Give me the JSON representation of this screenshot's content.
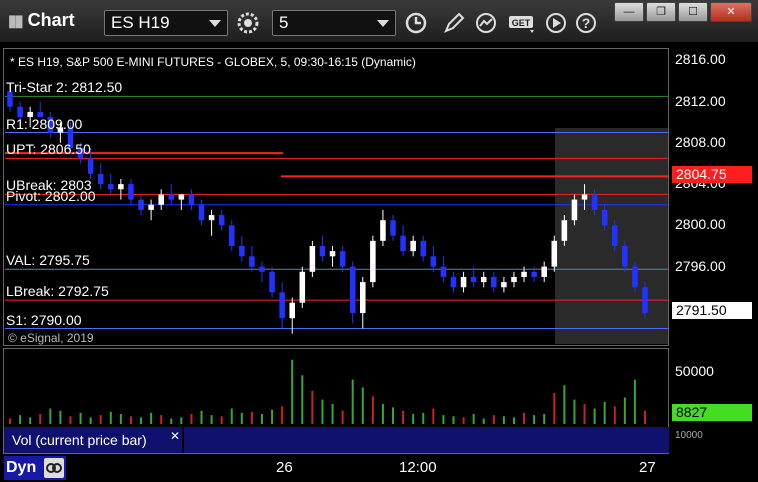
{
  "window": {
    "title": "Chart",
    "symbol": "ES H19",
    "interval": "5",
    "buttons": {
      "minimize": "—",
      "restore": "❐",
      "maximize": "☐",
      "close": "✕"
    }
  },
  "chart": {
    "header": "* ES H19, S&P 500 E-MINI FUTURES - GLOBEX, 5, 09:30-16:15 (Dynamic)",
    "copyright": "© eSignal, 2019",
    "levels": [
      {
        "name": "Tri-Star 2",
        "label": "Tri-Star 2: 2812.50",
        "color": "#2e8b2e"
      },
      {
        "name": "R1",
        "label": "R1: 2809.00",
        "color": "#4a6cff"
      },
      {
        "name": "UPT",
        "label": "UPT: 2806.50",
        "color": "#ff2020"
      },
      {
        "name": "UBreak",
        "label": "UBreak: 2803",
        "color": "#ff2020"
      },
      {
        "name": "Pivot",
        "label": "Pivot: 2802.00",
        "color": "#2233ff"
      },
      {
        "name": "VAL",
        "label": "VAL: 2795.75",
        "color": "#2aa0a0"
      },
      {
        "name": "LBreak",
        "label": "LBreak: 2792.75",
        "color": "#ff2020"
      },
      {
        "name": "S1",
        "label": "S1: 2790.00",
        "color": "#4a6cff"
      }
    ],
    "price_axis": [
      "2816.00",
      "2812.00",
      "2808.00",
      "2804.00",
      "2800.00",
      "2796.00",
      "2792.00"
    ],
    "price_tags": {
      "upt_tag": "2804.75",
      "last_price": "2791.50"
    },
    "volume_axis": [
      "50000",
      "10000"
    ],
    "volume_tag": "8827",
    "volume_label": "Vol (current price bar)",
    "time_axis": [
      "26",
      "12:00",
      "27"
    ],
    "dyn_label": "Dyn"
  },
  "chart_data": {
    "type": "candlestick",
    "title": "* ES H19, S&P 500 E-MINI FUTURES - GLOBEX, 5, 09:30-16:15 (Dynamic)",
    "ylim": [
      2788.5,
      2817.0
    ],
    "ohlc": [
      [
        2813.0,
        2813.5,
        2811.0,
        2811.5
      ],
      [
        2811.5,
        2812.0,
        2810.0,
        2810.5
      ],
      [
        2810.5,
        2811.5,
        2809.5,
        2811.0
      ],
      [
        2811.0,
        2812.0,
        2810.5,
        2810.5
      ],
      [
        2810.5,
        2811.0,
        2808.5,
        2809.0
      ],
      [
        2809.0,
        2810.0,
        2808.0,
        2809.5
      ],
      [
        2809.5,
        2810.0,
        2807.0,
        2807.5
      ],
      [
        2807.5,
        2808.0,
        2806.0,
        2806.5
      ],
      [
        2806.5,
        2807.5,
        2804.5,
        2805.0
      ],
      [
        2805.0,
        2806.0,
        2803.5,
        2804.0
      ],
      [
        2804.0,
        2805.0,
        2803.0,
        2803.5
      ],
      [
        2803.5,
        2804.5,
        2802.5,
        2804.0
      ],
      [
        2804.0,
        2804.5,
        2802.0,
        2802.5
      ],
      [
        2802.5,
        2803.0,
        2801.0,
        2801.5
      ],
      [
        2801.5,
        2802.5,
        2800.5,
        2802.0
      ],
      [
        2802.0,
        2803.5,
        2801.5,
        2803.0
      ],
      [
        2803.0,
        2804.0,
        2802.0,
        2802.5
      ],
      [
        2802.5,
        2803.0,
        2801.5,
        2803.0
      ],
      [
        2803.0,
        2803.5,
        2801.5,
        2802.0
      ],
      [
        2802.0,
        2802.5,
        2800.0,
        2800.5
      ],
      [
        2800.5,
        2801.5,
        2799.0,
        2801.0
      ],
      [
        2801.0,
        2801.5,
        2799.5,
        2800.0
      ],
      [
        2800.0,
        2800.5,
        2797.5,
        2798.0
      ],
      [
        2798.0,
        2799.0,
        2796.5,
        2797.0
      ],
      [
        2797.0,
        2798.0,
        2795.5,
        2796.0
      ],
      [
        2796.0,
        2796.5,
        2794.5,
        2795.5
      ],
      [
        2795.5,
        2796.0,
        2793.0,
        2793.5
      ],
      [
        2793.5,
        2794.5,
        2790.0,
        2791.0
      ],
      [
        2791.0,
        2793.0,
        2789.5,
        2792.5
      ],
      [
        2792.5,
        2796.0,
        2792.0,
        2795.5
      ],
      [
        2795.5,
        2798.5,
        2795.0,
        2798.0
      ],
      [
        2798.0,
        2799.0,
        2796.5,
        2797.0
      ],
      [
        2797.0,
        2798.0,
        2796.0,
        2797.5
      ],
      [
        2797.5,
        2798.0,
        2795.5,
        2796.0
      ],
      [
        2796.0,
        2796.5,
        2790.5,
        2791.5
      ],
      [
        2791.5,
        2795.0,
        2790.0,
        2794.5
      ],
      [
        2794.5,
        2799.0,
        2794.0,
        2798.5
      ],
      [
        2798.5,
        2801.5,
        2798.0,
        2800.5
      ],
      [
        2800.5,
        2801.0,
        2798.5,
        2799.0
      ],
      [
        2799.0,
        2800.0,
        2797.0,
        2797.5
      ],
      [
        2797.5,
        2799.0,
        2797.0,
        2798.5
      ],
      [
        2798.5,
        2799.0,
        2796.5,
        2797.0
      ],
      [
        2797.0,
        2798.0,
        2795.5,
        2796.0
      ],
      [
        2796.0,
        2797.0,
        2794.5,
        2795.0
      ],
      [
        2795.0,
        2795.5,
        2793.5,
        2794.0
      ],
      [
        2794.0,
        2795.5,
        2793.5,
        2795.0
      ],
      [
        2795.0,
        2796.0,
        2794.0,
        2794.5
      ],
      [
        2794.5,
        2795.5,
        2794.0,
        2795.0
      ],
      [
        2795.0,
        2795.5,
        2793.5,
        2794.0
      ],
      [
        2794.0,
        2795.0,
        2793.5,
        2794.5
      ],
      [
        2794.5,
        2795.5,
        2794.0,
        2795.0
      ],
      [
        2795.0,
        2796.0,
        2794.5,
        2795.5
      ],
      [
        2795.5,
        2796.0,
        2794.5,
        2795.0
      ],
      [
        2795.0,
        2796.5,
        2794.5,
        2796.0
      ],
      [
        2796.0,
        2799.0,
        2795.5,
        2798.5
      ],
      [
        2798.5,
        2801.0,
        2798.0,
        2800.5
      ],
      [
        2800.5,
        2803.0,
        2800.0,
        2802.5
      ],
      [
        2802.5,
        2804.0,
        2801.5,
        2803.0
      ],
      [
        2803.0,
        2803.5,
        2801.0,
        2801.5
      ],
      [
        2801.5,
        2802.0,
        2799.5,
        2800.0
      ],
      [
        2800.0,
        2800.5,
        2797.5,
        2798.0
      ],
      [
        2798.0,
        2798.5,
        2795.5,
        2796.0
      ],
      [
        2796.0,
        2796.5,
        2793.5,
        2794.0
      ],
      [
        2794.0,
        2794.5,
        2791.0,
        2791.5
      ]
    ],
    "volume": [
      5,
      8,
      6,
      9,
      14,
      12,
      7,
      10,
      6,
      8,
      11,
      9,
      7,
      6,
      10,
      8,
      5,
      6,
      9,
      12,
      8,
      7,
      14,
      10,
      11,
      9,
      13,
      16,
      58,
      44,
      30,
      22,
      18,
      12,
      40,
      33,
      25,
      18,
      15,
      12,
      9,
      10,
      14,
      8,
      7,
      6,
      9,
      5,
      8,
      7,
      6,
      10,
      8,
      9,
      28,
      35,
      22,
      18,
      14,
      20,
      16,
      24,
      40,
      12
    ],
    "volume_ylim": [
      0,
      65000
    ]
  }
}
